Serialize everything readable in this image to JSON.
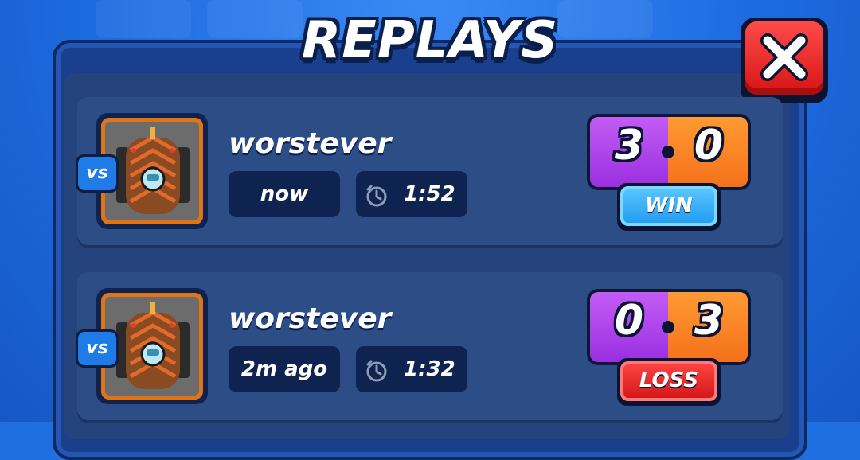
{
  "screen": {
    "title": "REPLAYS",
    "close_icon": "close-x-icon"
  },
  "replays": [
    {
      "player_name": "worstever",
      "vs_label": "vs",
      "time_ago": "now",
      "duration": "1:52",
      "score_left": "3",
      "score_right": "0",
      "result": "WIN",
      "result_color": "#1e9af0"
    },
    {
      "player_name": "worstever",
      "vs_label": "vs",
      "time_ago": "2m ago",
      "duration": "1:32",
      "score_left": "0",
      "score_right": "3",
      "result": "LOSS",
      "result_color": "#d11515"
    }
  ],
  "colors": {
    "left_score": "#9a2fe0",
    "right_score": "#f4711b",
    "panel": "#1a3f8c"
  }
}
